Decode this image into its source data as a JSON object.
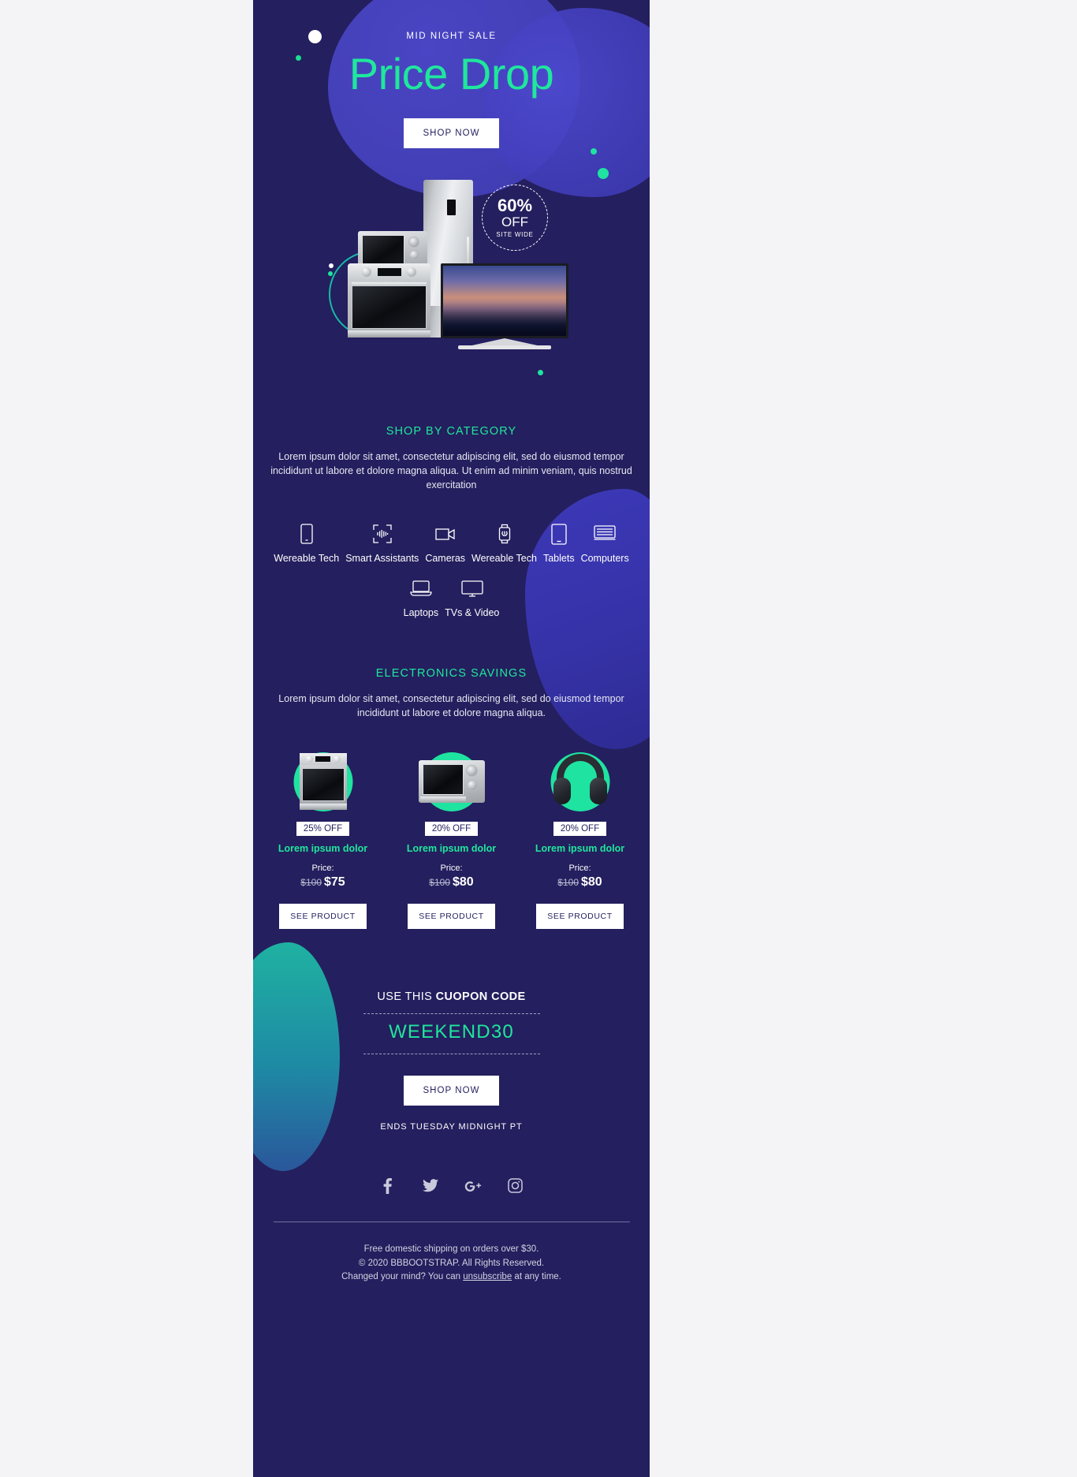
{
  "hero": {
    "eyebrow": "MID NIGHT SALE",
    "title": "Price Drop",
    "cta": "SHOP NOW"
  },
  "showcase": {
    "badge_percent": "60%",
    "badge_off": "OFF",
    "badge_sitewide": "SITE WIDE"
  },
  "category_section": {
    "title": "SHOP BY CATEGORY",
    "body": "Lorem ipsum dolor sit amet, consectetur adipiscing elit, sed do eiusmod tempor incididunt ut labore et dolore magna aliqua. Ut enim ad minim veniam, quis nostrud exercitation",
    "row1": [
      {
        "label": "Wereable Tech",
        "icon": "smartphone-icon"
      },
      {
        "label": "Smart Assistants",
        "icon": "smart-speaker-icon"
      },
      {
        "label": "Cameras",
        "icon": "video-camera-icon"
      },
      {
        "label": "Wereable Tech",
        "icon": "smartwatch-icon"
      },
      {
        "label": "Tablets",
        "icon": "tablet-icon"
      },
      {
        "label": "Computers",
        "icon": "desktop-computer-icon"
      }
    ],
    "row2": [
      {
        "label": "Laptops",
        "icon": "laptop-icon"
      },
      {
        "label": "TVs & Video",
        "icon": "television-icon"
      }
    ]
  },
  "savings_section": {
    "title": "ELECTRONICS SAVINGS",
    "body": "Lorem ipsum dolor sit amet, consectetur adipiscing elit, sed do eiusmod tempor incididunt ut labore et dolore magna aliqua.",
    "price_label": "Price:",
    "products": [
      {
        "image": "oven-product-image",
        "discount": "25% OFF",
        "name": "Lorem ipsum dolor",
        "price_old": "$100",
        "price_new": "$75",
        "cta": "SEE PRODUCT"
      },
      {
        "image": "microwave-product-image",
        "discount": "20% OFF",
        "name": "Lorem ipsum dolor",
        "price_old": "$100",
        "price_new": "$80",
        "cta": "SEE PRODUCT"
      },
      {
        "image": "headphones-product-image",
        "discount": "20% OFF",
        "name": "Lorem ipsum dolor",
        "price_old": "$100",
        "price_new": "$80",
        "cta": "SEE PRODUCT"
      }
    ]
  },
  "coupon": {
    "heading_prefix": "USE THIS ",
    "heading_strong": "CUOPON CODE",
    "code": "WEEKEND30",
    "cta": "SHOP NOW",
    "ends": "ENDS TUESDAY MIDNIGHT PT"
  },
  "footer": {
    "social": [
      {
        "name": "facebook-icon",
        "glyph": "f"
      },
      {
        "name": "twitter-icon",
        "glyph": "t"
      },
      {
        "name": "google-plus-icon",
        "glyph": "G+"
      },
      {
        "name": "instagram-icon",
        "glyph": "ig"
      }
    ],
    "shipping": "Free domestic shipping on orders over $30.",
    "copyright": "© 2020 BBBOOTSTRAP. All Rights Reserved.",
    "unsub_prefix": "Changed your mind? You can ",
    "unsub_link": "unsubscribe",
    "unsub_suffix": " at any time."
  },
  "colors": {
    "background": "#241f5e",
    "accent_green": "#1fe79c",
    "page_bg": "#f4f4f6",
    "white": "#ffffff"
  }
}
